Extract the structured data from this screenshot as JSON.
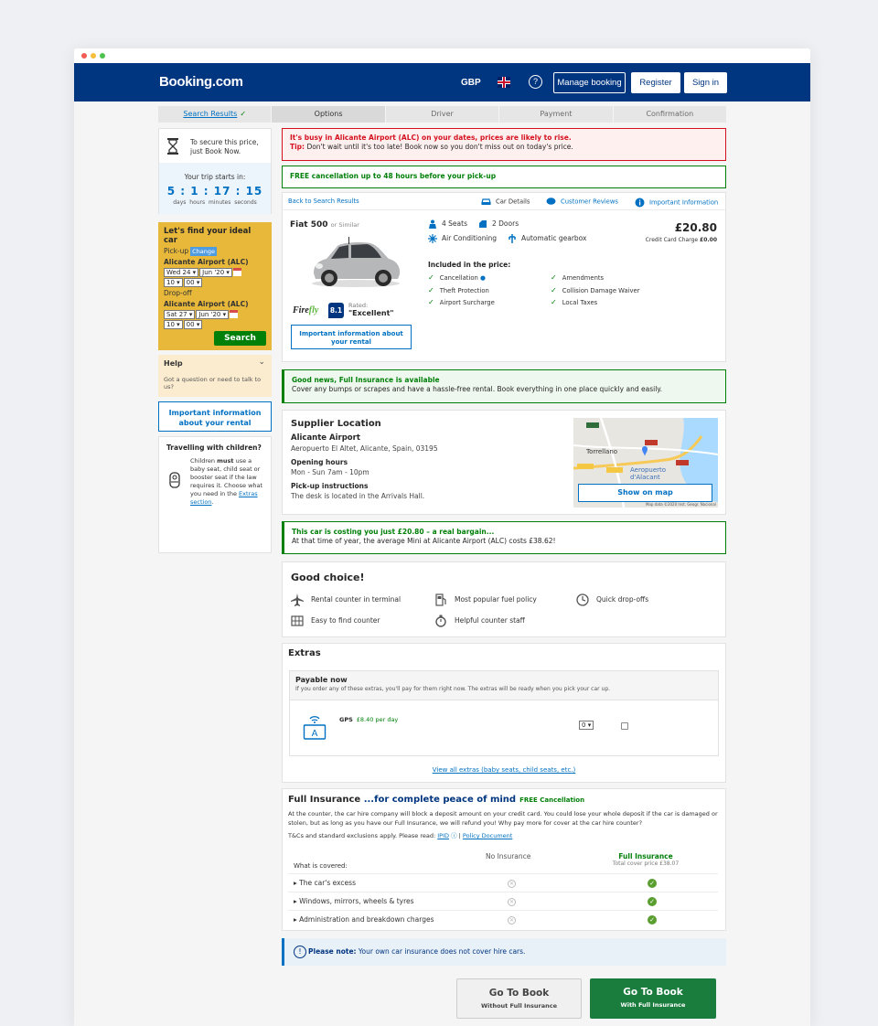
{
  "header": {
    "logo": "Booking.com",
    "currency": "GBP",
    "help_symbol": "?",
    "manage_booking": "Manage booking",
    "register": "Register",
    "sign_in": "Sign in"
  },
  "steps": [
    "Search Results",
    "Options",
    "Driver",
    "Payment",
    "Confirmation"
  ],
  "sidebar": {
    "secure_text_1": "To secure this price,",
    "secure_text_2": "just Book Now.",
    "trip_label": "Your trip starts in:",
    "timer": "5 : 1 : 17 : 15",
    "timer_labels": "days hours minutes seconds",
    "find_title": "Let's find your ideal car",
    "pickup_label": "Pick-up",
    "change_label": "Change",
    "pickup_location": "Alicante Airport (ALC)",
    "pickup_day": "Wed 24",
    "pickup_month": "Jun '20",
    "pickup_hour": "10",
    "pickup_min": "00",
    "dropoff_label": "Drop-off",
    "dropoff_location": "Alicante Airport (ALC)",
    "dropoff_day": "Sat 27",
    "dropoff_month": "Jun '20",
    "dropoff_hour": "10",
    "dropoff_min": "00",
    "search": "Search",
    "help_title": "Help",
    "help_text": "Got a question or need to talk to us?",
    "important_info": "Important information about your rental",
    "children_title": "Travelling with children?",
    "children_text_1": "Children ",
    "children_must": "must",
    "children_text_2": " use a baby seat, child seat or booster seat if the law requires it. Choose what you need in the ",
    "children_link": "Extras section",
    "children_end": "."
  },
  "alerts": {
    "busy": "It's busy in Alicante Airport (ALC) on your dates, prices are likely to rise.",
    "tip_label": "Tip:",
    "tip_text": " Don't wait until it's too late! Book now so you don't miss out on today's price.",
    "free_cancellation": "FREE cancellation up to 48 hours before your pick-up"
  },
  "car": {
    "back": "Back to Search Results",
    "tab_details": "Car Details",
    "tab_reviews": "Customer Reviews",
    "tab_info": "Important Information",
    "name": "Fiat 500",
    "similar": "or Similar",
    "seats": "4 Seats",
    "doors": "2 Doors",
    "ac": "Air Conditioning",
    "gearbox": "Automatic gearbox",
    "included_title": "Included in the price:",
    "included": [
      "Cancellation",
      "Theft Protection",
      "Airport Surcharge",
      "Amendments",
      "Collision Damage Waiver",
      "Local Taxes"
    ],
    "price": "£20.80",
    "cc_charge_label": "Credit Card Charge ",
    "cc_charge_value": "£0.00",
    "supplier": "Firefly",
    "rating": "8.1",
    "rated_label": "Rated:",
    "rated_text": "\"Excellent\"",
    "important_btn": "Important information about your rental"
  },
  "insurance_banner": {
    "title": "Good news, Full Insurance is available",
    "text": "Cover any bumps or scrapes and have a hassle-free rental. Book everything in one place quickly and easily."
  },
  "supplier_location": {
    "title": "Supplier Location",
    "name": "Alicante Airport",
    "address": "Aeropuerto El Altet, Alicante, Spain, 03195",
    "hours_title": "Opening hours",
    "hours": "Mon - Sun   7am - 10pm",
    "pickup_title": "Pick-up instructions",
    "pickup_text": "The desk is located in the Arrivals Hall.",
    "map_city": "Torrellano",
    "map_airport_1": "Aeropuerto",
    "map_airport_2": "d'Alacant",
    "map_credit": "Map data ©2020 Inst. Geogr. Nacional",
    "show_map": "Show on map"
  },
  "bargain": {
    "title": "This car is costing you just £20.80 – a real bargain...",
    "text": "At that time of year, the average Mini at Alicante Airport (ALC) costs £38.62!"
  },
  "good_choice": {
    "title": "Good choice!",
    "items": [
      "Rental counter in terminal",
      "Most popular fuel policy",
      "Quick drop-offs",
      "Easy to find counter",
      "Helpful counter staff"
    ]
  },
  "extras": {
    "title": "Extras",
    "pay_now": "Payable now",
    "pay_now_text": "If you order any of these extras, you'll pay for them right now. The extras will be ready when you pick your car up.",
    "gps": "GPS",
    "gps_price": "£8.40 per day",
    "gps_qty": "0",
    "view_all": "View all extras  (baby seats, child seats, etc.)"
  },
  "full_insurance": {
    "title_1": "Full Insurance",
    "title_2": " ...for complete peace of mind",
    "free": "FREE Cancellation",
    "text": "At the counter, the car hire company will block a deposit amount on your credit card.  You could lose your whole deposit if the car is damaged or stolen, but as long as you have our Full Insurance, we will refund you!  Why pay more for cover at the car hire counter?",
    "tc": "T&Cs and standard exclusions apply. Please read: ",
    "ipid": "IPID",
    "policy": "Policy Document",
    "no_ins": "No Insurance",
    "full_ins": "Full Insurance",
    "total": "Total cover price £38.07",
    "covered": "What is covered:",
    "rows": [
      "The car's excess",
      "Windows, mirrors, wheels & tyres",
      "Administration and breakdown charges"
    ]
  },
  "note": {
    "label": "Please note:",
    "text": " Your own car insurance does not cover hire cars."
  },
  "buttons": {
    "go_book": "Go To Book",
    "without": "Without Full Insurance",
    "with": "With Full Insurance"
  },
  "colors": {
    "brand": "#003580",
    "link": "#0071c2",
    "green": "#008009",
    "red": "#d4111e",
    "yellow": "#e8b83a"
  }
}
